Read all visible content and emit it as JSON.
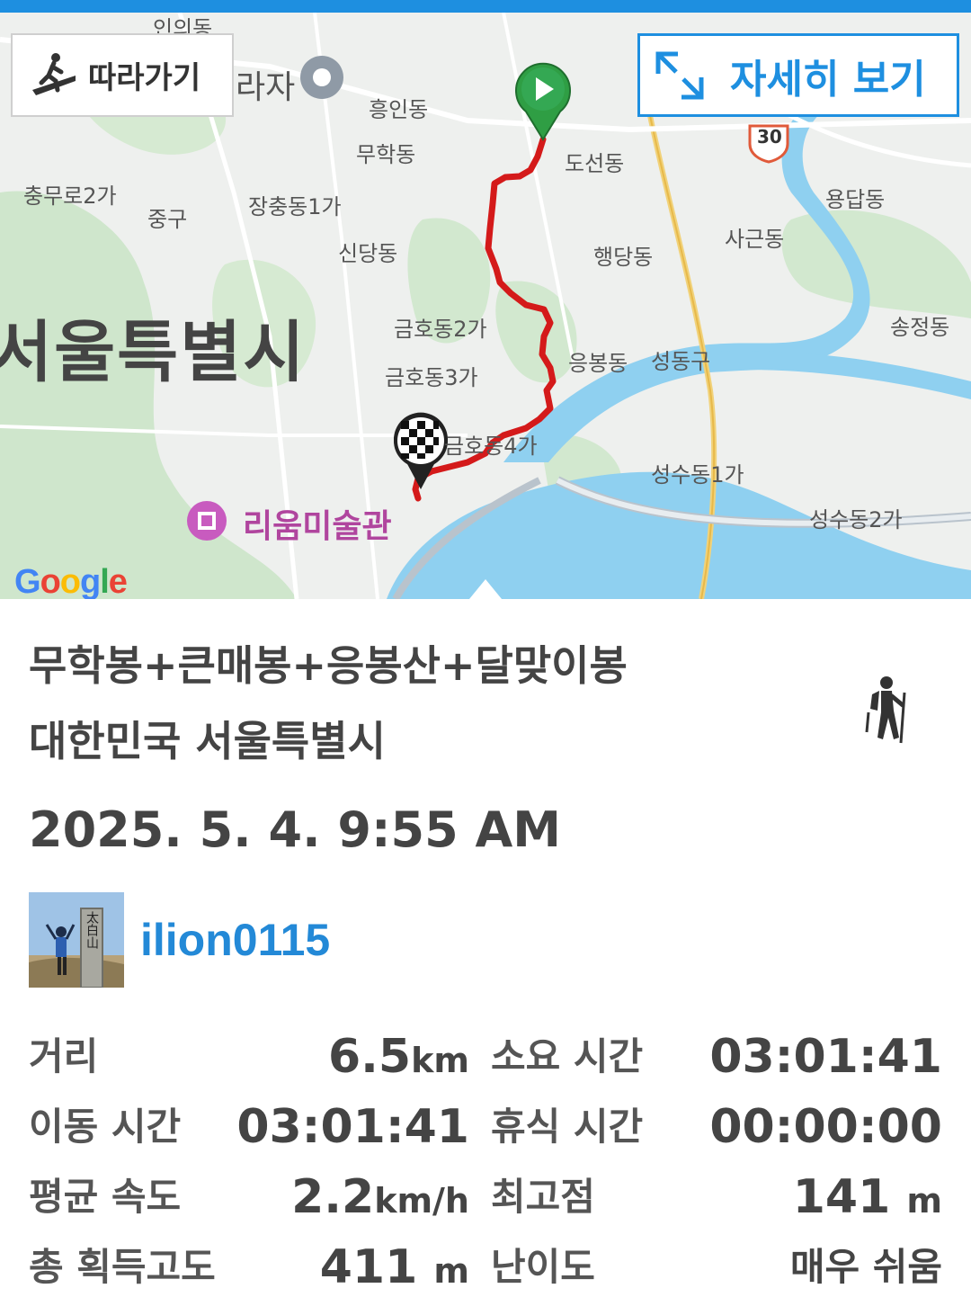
{
  "map": {
    "labels": {
      "top_partial": "인의동",
      "heungin": "흥인동",
      "muhak": "무학동",
      "doseon": "도선동",
      "chungmuro": "충무로2가",
      "junggu": "중구",
      "jangchung": "장충동1가",
      "sindang": "신당동",
      "haengdang": "행당동",
      "sageun": "사근동",
      "yongdap": "용답동",
      "seoul": "서울특별시",
      "geumho2": "금호동2가",
      "geumho3": "금호동3가",
      "geumho4": "금호동4가",
      "eungbong": "응봉동",
      "seongdonggu": "성동구",
      "songjeong": "송정동",
      "seongsu1": "성수동1가",
      "seongsu2": "성수동2가",
      "left_partial": "라자",
      "road_number": "30"
    },
    "poi_leeum": "리움미술관",
    "google": [
      "G",
      "o",
      "o",
      "g",
      "l",
      "e"
    ],
    "route_color": "#d41a1a"
  },
  "buttons": {
    "follow": "따라가기",
    "detail": "자세히 보기"
  },
  "track": {
    "title": "무학봉+큰매봉+응봉산+달맞이봉",
    "region": "대한민국 서울특별시",
    "datetime": "2025. 5. 4. 9:55 AM",
    "activity_icon": "hiker-icon"
  },
  "user": {
    "username": "ilion0115",
    "avatar_sign": "太白山"
  },
  "stats": [
    {
      "label1": "거리",
      "value1": "6.5",
      "unit1": "km",
      "label2": "소요 시간",
      "value2": "03:01:41",
      "unit2": ""
    },
    {
      "label1": "이동 시간",
      "value1": "03:01:41",
      "unit1": "",
      "label2": "휴식 시간",
      "value2": "00:00:00",
      "unit2": ""
    },
    {
      "label1": "평균 속도",
      "value1": "2.2",
      "unit1": "km/h",
      "label2": "최고점",
      "value2": "141",
      "unit2": "m"
    },
    {
      "label1": "총 획득고도",
      "value1": "411",
      "unit1": "m",
      "label2": "난이도",
      "value2": "매우 쉬움",
      "unit2": ""
    }
  ]
}
